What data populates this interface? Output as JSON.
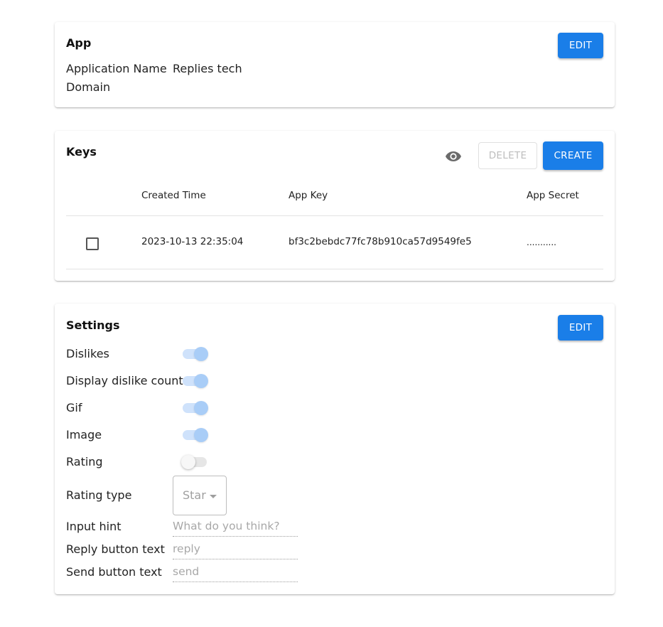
{
  "app": {
    "title": "App",
    "edit_label": "EDIT",
    "fields": [
      {
        "label": "Application Name",
        "value": "Replies tech"
      },
      {
        "label": "Domain",
        "value": ""
      }
    ]
  },
  "keys": {
    "title": "Keys",
    "visibility_icon": "eye-icon",
    "delete_label": "DELETE",
    "create_label": "CREATE",
    "columns": [
      "",
      "Created Time",
      "App Key",
      "App Secret"
    ],
    "rows": [
      {
        "checked": false,
        "created_time": "2023-10-13 22:35:04",
        "app_key": "bf3c2bebdc77fc78b910ca57d9549fe5",
        "app_secret": "..........."
      }
    ]
  },
  "settings": {
    "title": "Settings",
    "edit_label": "EDIT",
    "toggles": [
      {
        "label": "Dislikes",
        "on": true
      },
      {
        "label": "Display dislike count",
        "on": true
      },
      {
        "label": "Gif",
        "on": true
      },
      {
        "label": "Image",
        "on": true
      },
      {
        "label": "Rating",
        "on": false
      }
    ],
    "rating_type": {
      "label": "Rating type",
      "selected": "Star"
    },
    "inputs": [
      {
        "label": "Input hint",
        "value": "",
        "placeholder": "What do you think?"
      },
      {
        "label": "Reply button text",
        "value": "",
        "placeholder": "reply"
      },
      {
        "label": "Send button text",
        "value": "",
        "placeholder": "send"
      }
    ]
  },
  "colors": {
    "primary": "#1a7ee8",
    "toggle_on_track": "#cfe2fb",
    "toggle_on_thumb": "#a9cdf7"
  }
}
